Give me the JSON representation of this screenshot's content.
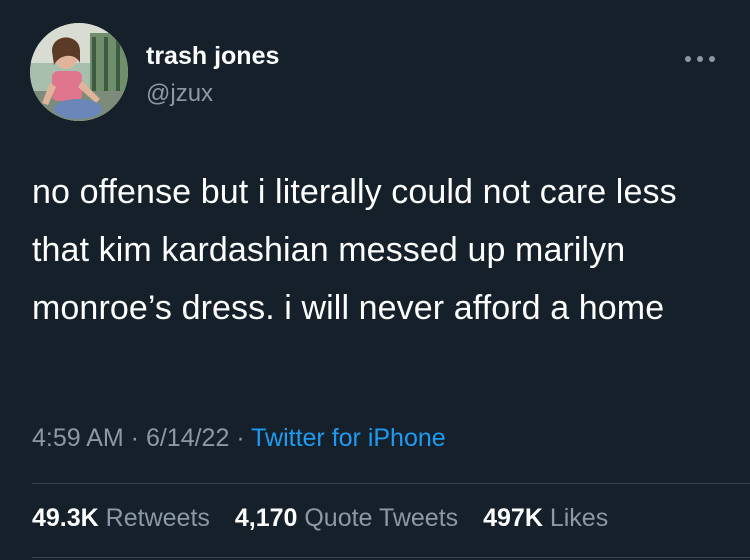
{
  "author": {
    "display_name": "trash jones",
    "handle": "@jzux"
  },
  "icons": {
    "more": "more-options-icon",
    "avatar": "profile-photo"
  },
  "tweet": {
    "text": "no offense but i literally could not care less that kim kardashian messed up marilyn monroe’s dress. i will never afford a home",
    "time": "4:59 AM",
    "separator_1": " · ",
    "date": "6/14/22",
    "separator_2": " · ",
    "source": "Twitter for iPhone"
  },
  "stats": {
    "retweets_count": "49.3K",
    "retweets_label": "Retweets",
    "quotes_count": "4,170",
    "quotes_label": "Quote Tweets",
    "likes_count": "497K",
    "likes_label": "Likes"
  },
  "colors": {
    "background": "#15202b",
    "primary_text": "#ffffff",
    "secondary_text": "#8b98a5",
    "link": "#1d9bf0",
    "divider": "#38444d"
  }
}
